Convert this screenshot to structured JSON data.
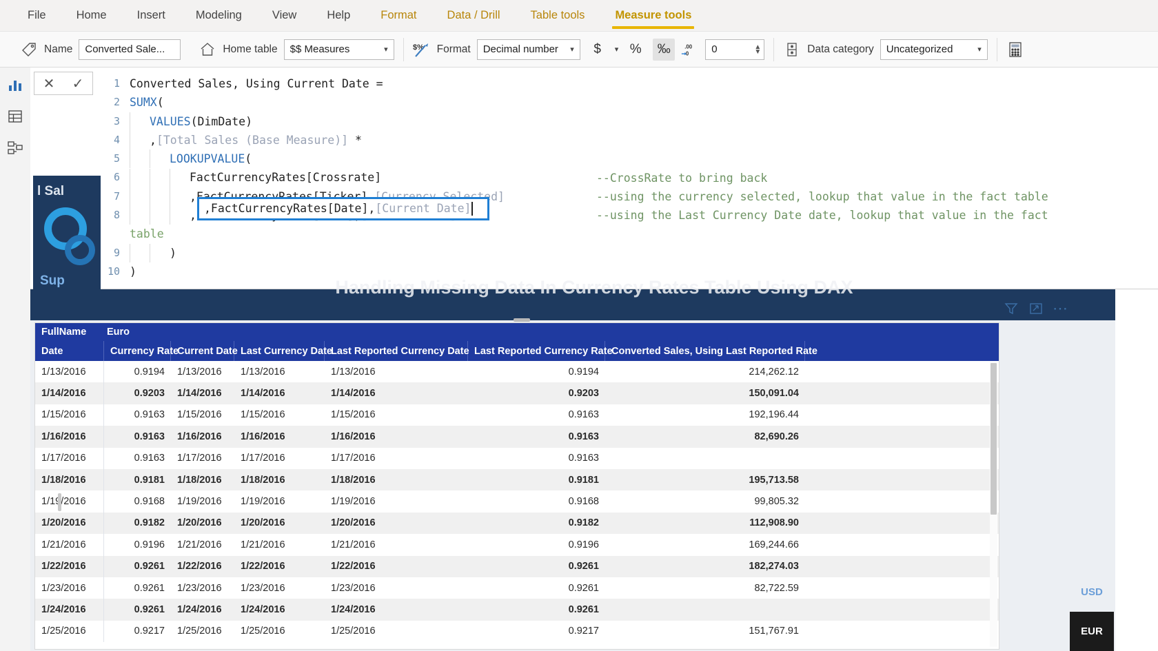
{
  "ribbon": {
    "tabs": [
      {
        "label": "File",
        "type": "normal"
      },
      {
        "label": "Home",
        "type": "normal"
      },
      {
        "label": "Insert",
        "type": "normal"
      },
      {
        "label": "Modeling",
        "type": "normal"
      },
      {
        "label": "View",
        "type": "normal"
      },
      {
        "label": "Help",
        "type": "normal"
      },
      {
        "label": "Format",
        "type": "context"
      },
      {
        "label": "Data / Drill",
        "type": "context"
      },
      {
        "label": "Table tools",
        "type": "context"
      },
      {
        "label": "Measure tools",
        "type": "active"
      }
    ],
    "accent_color": "#e8b500",
    "name_label": "Name",
    "name_value": "Converted Sale...",
    "home_table_label": "Home table",
    "home_table_value": "$$ Measures",
    "format_label": "Format",
    "format_value": "Decimal number",
    "currency_symbol": "$",
    "percent_symbol": "%",
    "thousands_symbol": "‰",
    "decimal_places_value": "0",
    "data_category_label": "Data category",
    "data_category_value": "Uncategorized",
    "icons": {
      "name": "tag-icon",
      "home_table": "home-icon",
      "format": "format-icon",
      "decimal": "decimal-places-icon",
      "data_category": "data-category-icon",
      "calculator": "calculator-icon"
    }
  },
  "rail": {
    "items": [
      {
        "name": "report-view-icon"
      },
      {
        "name": "data-view-icon"
      },
      {
        "name": "model-view-icon"
      }
    ]
  },
  "formula": {
    "cancel_label": "✕",
    "commit_label": "✓",
    "lines": [
      {
        "n": "1",
        "indent": 0,
        "segments": [
          {
            "t": "Converted Sales, Using Current Date =",
            "c": "plain"
          }
        ]
      },
      {
        "n": "2",
        "indent": 0,
        "segments": [
          {
            "t": "SUMX",
            "c": "kw"
          },
          {
            "t": "(",
            "c": "plain"
          }
        ]
      },
      {
        "n": "3",
        "indent": 1,
        "segments": [
          {
            "t": "VALUES",
            "c": "kw"
          },
          {
            "t": "(DimDate)",
            "c": "plain"
          }
        ]
      },
      {
        "n": "4",
        "indent": 1,
        "segments": [
          {
            "t": ",",
            "c": "plain"
          },
          {
            "t": "[Total Sales (Base Measure)]",
            "c": "meas"
          },
          {
            "t": " *",
            "c": "plain"
          }
        ]
      },
      {
        "n": "5",
        "indent": 2,
        "segments": [
          {
            "t": "LOOKUPVALUE",
            "c": "kw"
          },
          {
            "t": "(",
            "c": "plain"
          }
        ]
      },
      {
        "n": "6",
        "indent": 3,
        "segments": [
          {
            "t": "FactCurrencyRates[Crossrate]",
            "c": "plain"
          }
        ]
      },
      {
        "n": "7",
        "indent": 3,
        "segments": [
          {
            "t": ",FactCurrencyRates[Ticker],",
            "c": "plain"
          },
          {
            "t": "[Currency Selected]",
            "c": "meas"
          }
        ]
      },
      {
        "n": "8",
        "indent": 3,
        "segments": [
          {
            "t": ",FactCurrencyRates[Date],",
            "c": "plain"
          },
          {
            "t": "[Current Date]",
            "c": "meas"
          }
        ]
      },
      {
        "n": "",
        "indent": 0,
        "segments": [
          {
            "t": "table",
            "c": "grn"
          }
        ]
      },
      {
        "n": "9",
        "indent": 2,
        "segments": [
          {
            "t": ")",
            "c": "plain"
          }
        ]
      },
      {
        "n": "10",
        "indent": 0,
        "segments": [
          {
            "t": ")",
            "c": "plain"
          }
        ]
      }
    ],
    "highlighted_line": ",FactCurrencyRates[Date],[Current Date]",
    "highlighted_plain": ",FactCurrencyRates[Date],",
    "highlighted_meas": "[Current Date]",
    "highlight_color": "#1f7fd4",
    "comments": [
      "--CrossRate to bring back",
      "--using the currency selected, lookup that value in the fact table",
      "--using the Last Currency Date date, lookup that value in the fact"
    ]
  },
  "canvas": {
    "banner_title": "Handling Missing Data In Currency Rates Table Using DAX",
    "tile_line1": "l Sal",
    "tile_line2": "Sup",
    "viz_tools": [
      {
        "name": "filter-icon",
        "glyph": "∇"
      },
      {
        "name": "focus-mode-icon",
        "glyph": "⧉"
      },
      {
        "name": "more-options-icon",
        "glyph": "⋯"
      }
    ]
  },
  "table": {
    "group_header": {
      "col1": "FullName",
      "col2": "Euro"
    },
    "columns": [
      "Date",
      "Currency Rate",
      "Current Date",
      "Last Currency Date",
      "Last Reported Currency Date",
      "Last Reported Currency Rate",
      "Converted Sales, Using Last Reported Rate"
    ],
    "rows": [
      [
        "1/13/2016",
        "0.9194",
        "1/13/2016",
        "1/13/2016",
        "1/13/2016",
        "0.9194",
        "214,262.12"
      ],
      [
        "1/14/2016",
        "0.9203",
        "1/14/2016",
        "1/14/2016",
        "1/14/2016",
        "0.9203",
        "150,091.04"
      ],
      [
        "1/15/2016",
        "0.9163",
        "1/15/2016",
        "1/15/2016",
        "1/15/2016",
        "0.9163",
        "192,196.44"
      ],
      [
        "1/16/2016",
        "0.9163",
        "1/16/2016",
        "1/16/2016",
        "1/16/2016",
        "0.9163",
        "82,690.26"
      ],
      [
        "1/17/2016",
        "0.9163",
        "1/17/2016",
        "1/17/2016",
        "1/17/2016",
        "0.9163",
        ""
      ],
      [
        "1/18/2016",
        "0.9181",
        "1/18/2016",
        "1/18/2016",
        "1/18/2016",
        "0.9181",
        "195,713.58"
      ],
      [
        "1/19/2016",
        "0.9168",
        "1/19/2016",
        "1/19/2016",
        "1/19/2016",
        "0.9168",
        "99,805.32"
      ],
      [
        "1/20/2016",
        "0.9182",
        "1/20/2016",
        "1/20/2016",
        "1/20/2016",
        "0.9182",
        "112,908.90"
      ],
      [
        "1/21/2016",
        "0.9196",
        "1/21/2016",
        "1/21/2016",
        "1/21/2016",
        "0.9196",
        "169,244.66"
      ],
      [
        "1/22/2016",
        "0.9261",
        "1/22/2016",
        "1/22/2016",
        "1/22/2016",
        "0.9261",
        "182,274.03"
      ],
      [
        "1/23/2016",
        "0.9261",
        "1/23/2016",
        "1/23/2016",
        "1/23/2016",
        "0.9261",
        "82,722.59"
      ],
      [
        "1/24/2016",
        "0.9261",
        "1/24/2016",
        "1/24/2016",
        "1/24/2016",
        "0.9261",
        ""
      ],
      [
        "1/25/2016",
        "0.9217",
        "1/25/2016",
        "1/25/2016",
        "1/25/2016",
        "0.9217",
        "151,767.91"
      ]
    ],
    "header_bg": "#1f3aa0"
  },
  "slicer": {
    "buttons": [
      {
        "label": "USD",
        "selected": false
      },
      {
        "label": "EUR",
        "selected": true
      }
    ]
  }
}
